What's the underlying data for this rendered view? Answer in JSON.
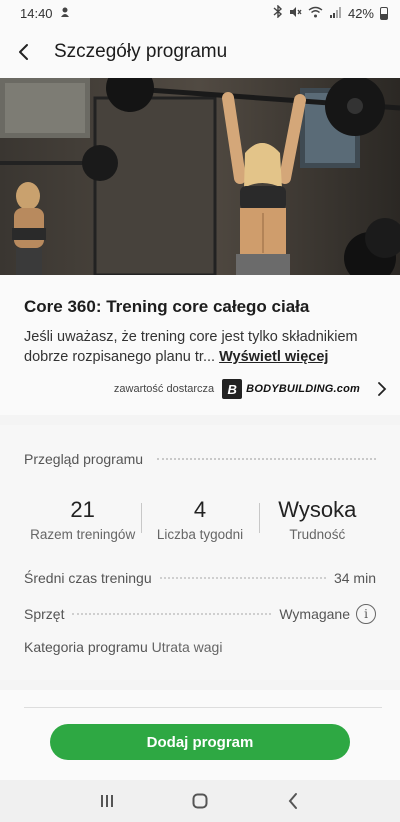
{
  "status_bar": {
    "time": "14:40",
    "battery": "42%",
    "icons": [
      "notification-icon",
      "bluetooth-icon",
      "mute-icon",
      "wifi-icon",
      "signal-icon",
      "battery-icon"
    ]
  },
  "header": {
    "title": "Szczegóły programu",
    "back_icon": "arrow-left-icon"
  },
  "program": {
    "title": "Core 360: Trening core całego ciała",
    "description": "Jeśli uważasz, że trening core jest tylko składnikiem dobrze rozpisanego planu tr...",
    "more_link": "Wyświetl więcej",
    "provider_label": "zawartość dostarcza",
    "provider_logo_mark": "B",
    "provider_logo_text": "BODYBUILDING.com"
  },
  "overview": {
    "title": "Przegląd programu",
    "stats": [
      {
        "value": "21",
        "label": "Razem treningów"
      },
      {
        "value": "4",
        "label": "Liczba tygodni"
      },
      {
        "value": "Wysoka",
        "label": "Trudność"
      }
    ],
    "avg_time_label": "Średni czas treningu",
    "avg_time_value": "34 min",
    "equipment_label": "Sprzęt",
    "equipment_value": "Wymagane",
    "category_label": "Kategoria programu",
    "category_value": "Utrata wagi"
  },
  "actions": {
    "add_program": "Dodaj program"
  },
  "colors": {
    "accent_green": "#2ea843"
  }
}
